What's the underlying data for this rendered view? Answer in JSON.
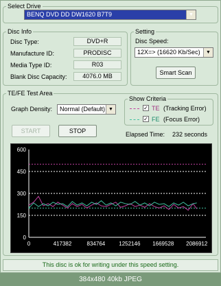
{
  "select_drive": {
    "legend": "Select Drive",
    "drive": "BENQ    DVD DD DW1620   B7T9"
  },
  "disc_info": {
    "legend": "Disc Info",
    "rows": [
      {
        "label": "Disc Type:",
        "value": "DVD+R"
      },
      {
        "label": "Manufacture ID:",
        "value": "PRODISC"
      },
      {
        "label": "Media Type ID:",
        "value": "R03"
      },
      {
        "label": "Blank Disc Capacity:",
        "value": "4076.0 MB"
      }
    ]
  },
  "setting": {
    "legend": "Setting",
    "disc_speed_label": "Disc Speed:",
    "disc_speed_value": "12X=> (16620 Kb/Sec)",
    "smart_scan_label": "Smart Scan"
  },
  "test_area": {
    "legend": "TE/FE Test Area",
    "graph_density_label": "Graph Density:",
    "graph_density_value": "Normal (Default)",
    "start_label": "START",
    "stop_label": "STOP",
    "elapsed_label": "Elapsed Time:",
    "elapsed_value": "232 seconds"
  },
  "show_criteria": {
    "legend": "Show Criteria",
    "items": [
      {
        "code": "TE",
        "text": "(Tracking Error)",
        "color": "#c040a0",
        "checked": true
      },
      {
        "code": "FE",
        "text": "(Focus Error)",
        "color": "#40c0a0",
        "checked": true
      }
    ]
  },
  "status_message": "This disc is ok for writing under this speed setting.",
  "caption": "384x480 40kb JPEG",
  "chart_data": {
    "type": "line",
    "ylim": [
      0,
      600
    ],
    "yticks": [
      "0",
      "150",
      "300",
      "450",
      "600"
    ],
    "xlim": [
      0,
      2200000
    ],
    "xticks": [
      "0",
      "417382",
      "834764",
      "1252146",
      "1669528",
      "2086912"
    ],
    "xtick_values": [
      0,
      417382,
      834764,
      1252146,
      1669528,
      2086912
    ],
    "threshold_lines": [
      {
        "value": 500,
        "color": "#c040a0"
      },
      {
        "value": 450,
        "color": "#ffffff"
      },
      {
        "value": 300,
        "color": "#ffffff"
      },
      {
        "value": 200,
        "color": "#40c0a0"
      },
      {
        "value": 150,
        "color": "#ffffff"
      }
    ],
    "series": [
      {
        "color": "#c040a0",
        "x": [
          0,
          60000,
          120000,
          180000,
          240000,
          300000,
          360000,
          420000,
          480000,
          540000,
          600000,
          660000,
          720000,
          780000,
          840000,
          900000,
          960000,
          1020000,
          1080000,
          1140000,
          1200000,
          1260000,
          1320000,
          1380000,
          1440000,
          1500000,
          1560000,
          1620000,
          1680000,
          1740000,
          1800000,
          1860000,
          1920000,
          1980000,
          2040000,
          2086912
        ],
        "y": [
          220,
          240,
          280,
          215,
          230,
          210,
          240,
          220,
          200,
          230,
          210,
          225,
          200,
          220,
          235,
          215,
          210,
          225,
          240,
          205,
          215,
          230,
          210,
          220,
          205,
          230,
          210,
          200,
          215,
          190,
          225,
          200,
          210,
          185,
          230,
          195
        ]
      },
      {
        "color": "#40c0a0",
        "x": [
          0,
          60000,
          120000,
          180000,
          240000,
          300000,
          360000,
          420000,
          480000,
          540000,
          600000,
          660000,
          720000,
          780000,
          840000,
          900000,
          960000,
          1020000,
          1080000,
          1140000,
          1200000,
          1260000,
          1320000,
          1380000,
          1440000,
          1500000,
          1560000,
          1620000,
          1680000,
          1740000,
          1800000,
          1860000,
          1920000,
          1980000,
          2040000,
          2086912
        ],
        "y": [
          200,
          235,
          210,
          230,
          215,
          240,
          225,
          230,
          210,
          245,
          220,
          235,
          215,
          240,
          225,
          250,
          220,
          235,
          215,
          240,
          230,
          225,
          245,
          220,
          235,
          215,
          240,
          225,
          230,
          210,
          235,
          220,
          240,
          215,
          230,
          235
        ]
      }
    ]
  }
}
